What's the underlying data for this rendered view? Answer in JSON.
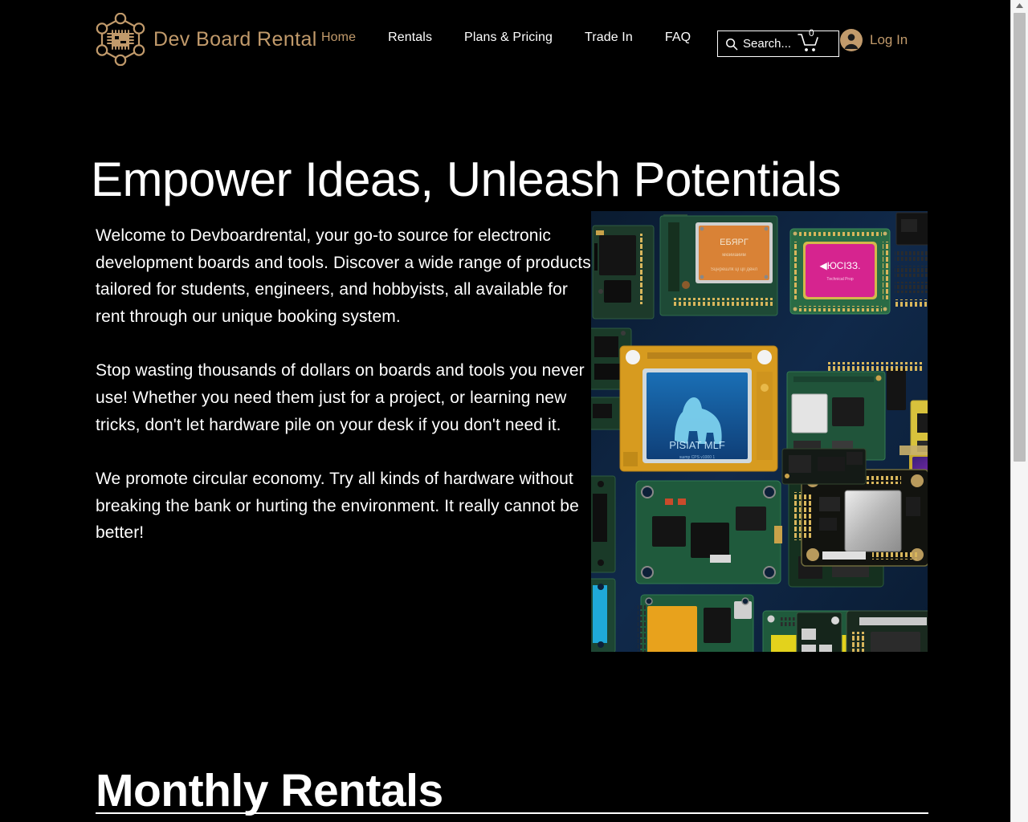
{
  "header": {
    "brand_name": "Dev Board Rental",
    "logo_icon": "hexagon-chip-logo-icon",
    "nav_items": [
      {
        "label": "Home",
        "active": true
      },
      {
        "label": "Rentals",
        "active": false
      },
      {
        "label": "Plans & Pricing",
        "active": false
      },
      {
        "label": "Trade In",
        "active": false
      },
      {
        "label": "FAQ",
        "active": false
      }
    ],
    "search": {
      "placeholder": "Search...",
      "value": "",
      "icon": "search-icon"
    },
    "cart": {
      "icon": "shopping-cart-icon",
      "count": "0"
    },
    "account": {
      "avatar_icon": "user-avatar-icon",
      "login_label": "Log In"
    }
  },
  "hero": {
    "title": "Empower Ideas, Unleash Potentials"
  },
  "intro": {
    "paragraphs": [
      "Welcome to Devboardrental, your go-to source for electronic development boards and tools. Discover a wide range of products tailored for students, engineers, and hobbyists, all available for rent through our unique booking system.",
      "Stop wasting thousands of dollars on boards and tools you never use! Whether you need them just for a project, or learning new tricks, don't let hardware pile on your desk if you don't need it.",
      "We promote circular economy. Try all kinds of hardware without breaking the bank or hurting the environment. It really cannot be better!"
    ]
  },
  "collage": {
    "alt": "Grid collage of electronic development boards on a dark blue background",
    "board_labels": {
      "orange_chip": "EБЯРГ",
      "pink_board": "ЮСІЗЗ.",
      "pink_board_sub": "Tесhnісаl Prоp",
      "blue_display": "PISIAT MLF"
    }
  },
  "section": {
    "title": "Monthly Rentals"
  },
  "scrollbar": {
    "up_arrow_icon": "scroll-up-arrow-icon"
  },
  "colors": {
    "background": "#000000",
    "accent": "#C19A6B",
    "text": "#FFFFFF",
    "collage_bg": "#0D2038"
  }
}
